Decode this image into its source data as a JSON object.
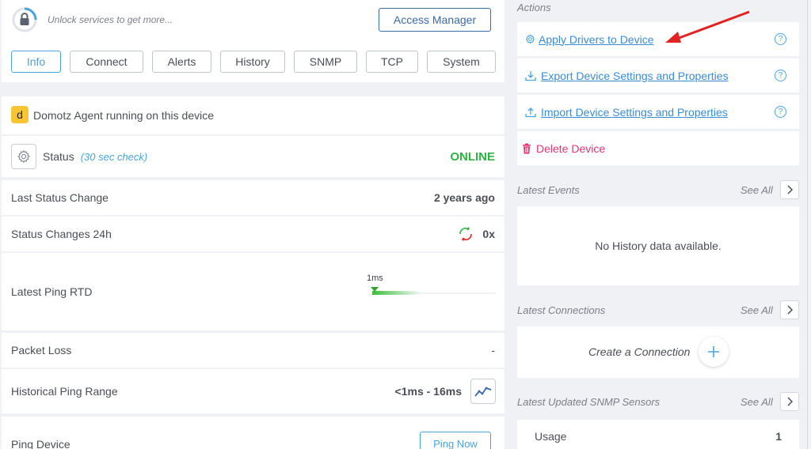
{
  "topbar": {
    "unlock_text": "Unlock services to get more...",
    "access_manager_label": "Access Manager"
  },
  "tabs": [
    {
      "label": "Info",
      "active": true
    },
    {
      "label": "Connect"
    },
    {
      "label": "Alerts"
    },
    {
      "label": "History"
    },
    {
      "label": "SNMP"
    },
    {
      "label": "TCP"
    },
    {
      "label": "System"
    }
  ],
  "agent": {
    "badge_letter": "d",
    "text": "Domotz Agent running on this device"
  },
  "status": {
    "label": "Status",
    "check": "(30 sec check)",
    "value": "ONLINE",
    "value_color": "#2fb344"
  },
  "details": {
    "last_status_change_label": "Last Status Change",
    "last_status_change_value": "2 years ago",
    "status_changes_label": "Status Changes 24h",
    "status_changes_value": "0x",
    "latest_ping_label": "Latest Ping RTD",
    "latest_ping_value": "1ms",
    "packet_loss_label": "Packet Loss",
    "packet_loss_value": "-",
    "historical_ping_label": "Historical Ping Range",
    "historical_ping_value": "<1ms - 16ms",
    "ping_device_label": "Ping Device",
    "ping_now_label": "Ping Now"
  },
  "actions": {
    "title": "Actions",
    "apply_drivers": "Apply Drivers to Device",
    "export": "Export Device Settings and Properties",
    "import": "Import Device Settings and Properties",
    "delete": "Delete Device",
    "help_glyph": "?"
  },
  "events": {
    "title": "Latest Events",
    "see_all": "See All",
    "empty": "No History data available."
  },
  "connections": {
    "title": "Latest Connections",
    "see_all": "See All",
    "create": "Create a Connection"
  },
  "snmp": {
    "title": "Latest Updated SNMP Sensors",
    "see_all": "See All",
    "row_label": "Usage",
    "row_value": "1"
  },
  "colors": {
    "accent": "#4aa3df",
    "link": "#3a8bd6",
    "online": "#2fb344",
    "delete": "#e5336f",
    "annotation_arrow": "#e02424"
  }
}
